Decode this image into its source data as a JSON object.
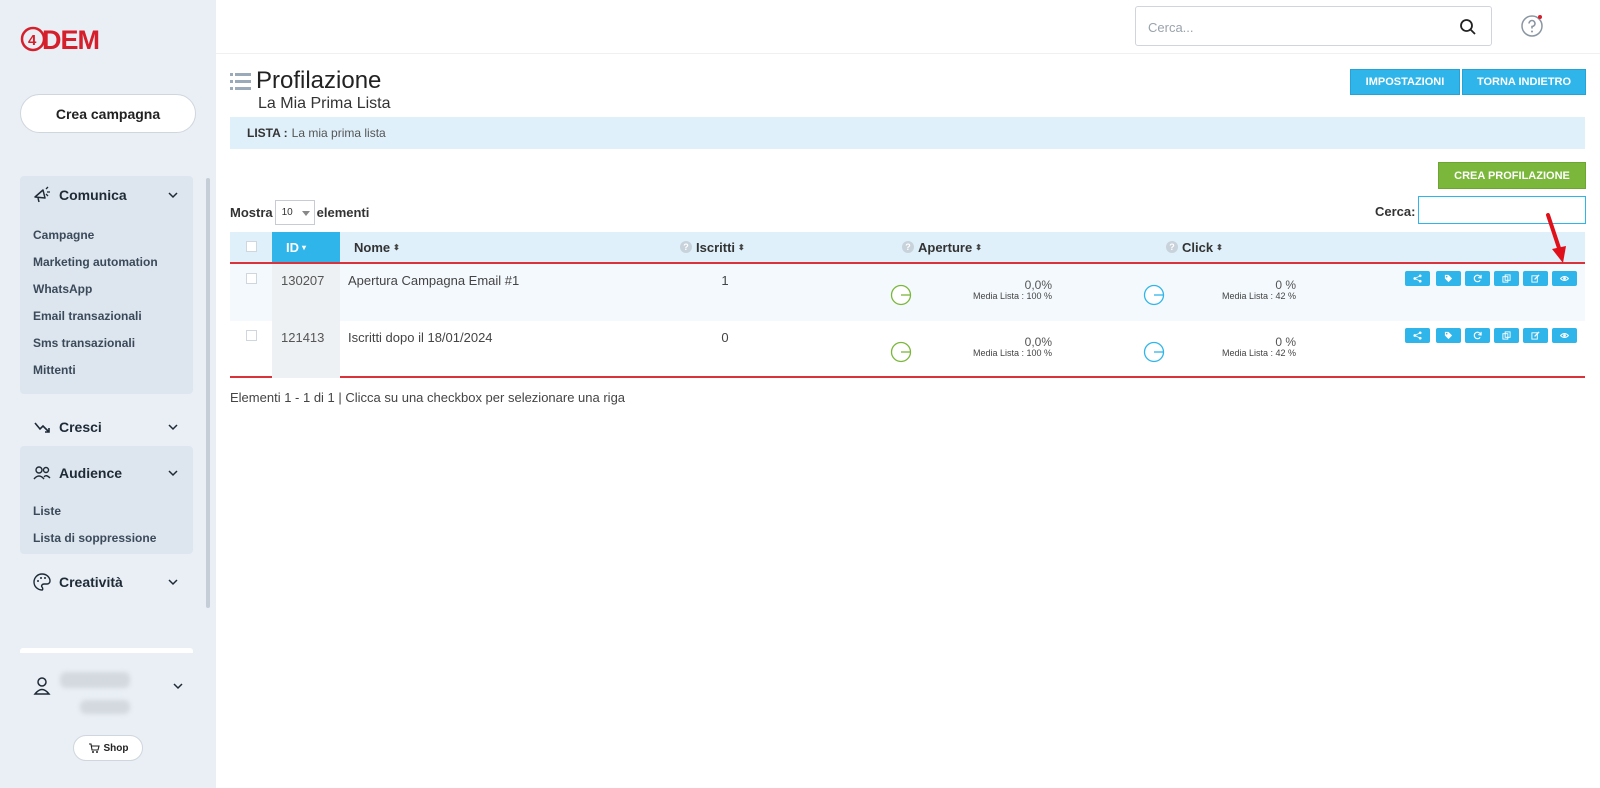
{
  "app": {
    "logo_text": "DEM",
    "logo_prefix": "4"
  },
  "sidebar": {
    "create_campaign": "Crea campagna",
    "groups": [
      {
        "label": "Comunica",
        "icon": "megaphone-icon",
        "items": [
          "Campagne",
          "Marketing automation",
          "WhatsApp",
          "Email transazionali",
          "Sms transazionali",
          "Mittenti"
        ]
      },
      {
        "label": "Cresci",
        "icon": "trend-arrow-icon",
        "items": []
      },
      {
        "label": "Audience",
        "icon": "users-icon",
        "items": [
          "Liste",
          "Lista di soppressione"
        ]
      },
      {
        "label": "Creatività",
        "icon": "palette-icon",
        "items": []
      }
    ],
    "shop": "Shop"
  },
  "topbar": {
    "search_placeholder": "Cerca..."
  },
  "page": {
    "title": "Profilazione",
    "subtitle": "La Mia Prima Lista",
    "btn_settings": "IMPOSTAZIONI",
    "btn_back": "TORNA INDIETRO",
    "lista_label": "LISTA :",
    "lista_value": "La mia prima lista",
    "btn_create": "CREA PROFILAZIONE",
    "show_label": "Mostra",
    "show_value": "10",
    "show_suffix": "elementi",
    "search_label": "Cerca:"
  },
  "table": {
    "columns": {
      "id": "ID",
      "name": "Nome",
      "iscritti": "Iscritti",
      "aperture": "Aperture",
      "click": "Click"
    },
    "rows": [
      {
        "id": "130207",
        "name": "Apertura Campagna Email #1",
        "iscritti": "1",
        "aperture_pct": "0,0%",
        "aperture_media": "Media Lista : 100 %",
        "click_pct": "0 %",
        "click_media": "Media Lista : 42 %"
      },
      {
        "id": "121413",
        "name": "Iscritti dopo il 18/01/2024",
        "iscritti": "0",
        "aperture_pct": "0,0%",
        "aperture_media": "Media Lista : 100 %",
        "click_pct": "0 %",
        "click_media": "Media Lista : 42 %"
      }
    ],
    "footer": "Elementi 1 - 1 di 1  | Clicca su una checkbox per selezionare una riga"
  },
  "colors": {
    "accent_blue": "#2fb5e9",
    "green": "#7ab73a",
    "red": "#d9323a",
    "sidebar_bg": "#e9eff5"
  }
}
